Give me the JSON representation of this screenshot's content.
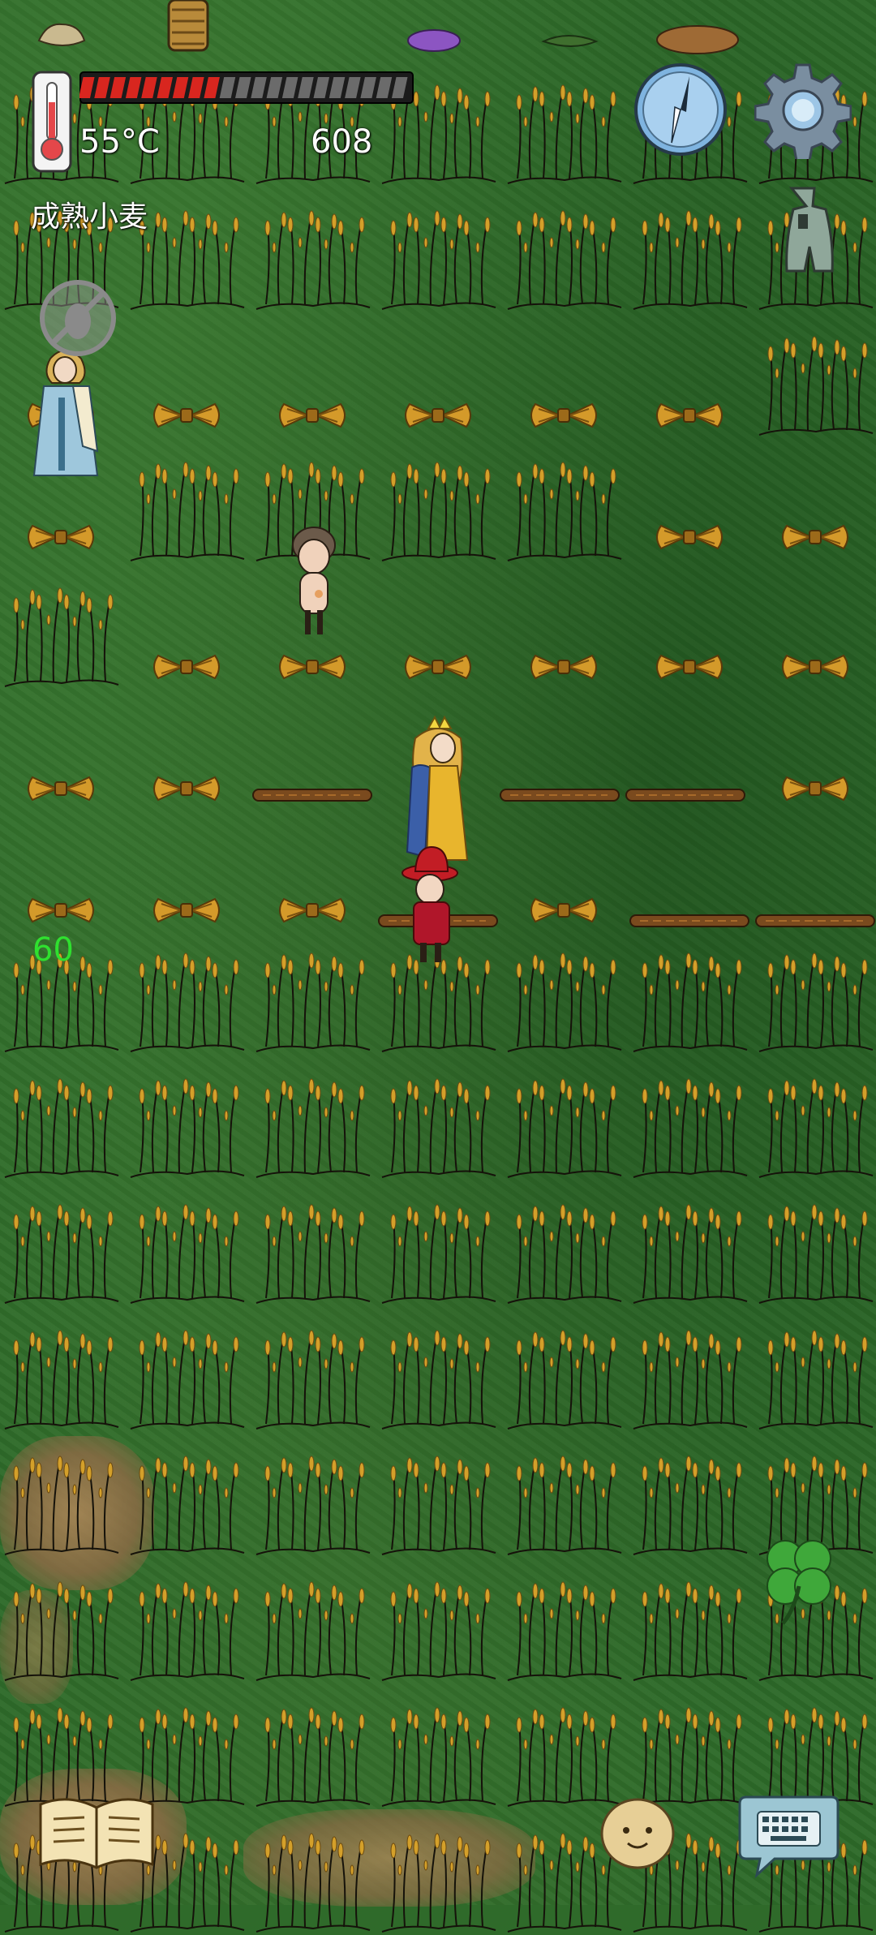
{
  "hud": {
    "temperature": "55°C",
    "count": "608",
    "health_fraction": 0.43,
    "object_label": "成熟小麦",
    "counter": "60"
  },
  "icons": {
    "thermometer": "thermometer-icon",
    "compass": "compass-icon",
    "settings": "gear-icon",
    "coin": "ancient-coin-icon",
    "no_insects": "no-bug-icon",
    "clover": "four-leaf-clover-icon",
    "book": "book-icon",
    "emote": "potato-face-icon",
    "keyboard": "keyboard-chat-icon"
  },
  "colors": {
    "health_fill": "#d8261f",
    "health_empty": "#6b6b6b",
    "counter": "#2fe02f",
    "grass": "#2d6a29",
    "wheat": "#d4a02a"
  }
}
